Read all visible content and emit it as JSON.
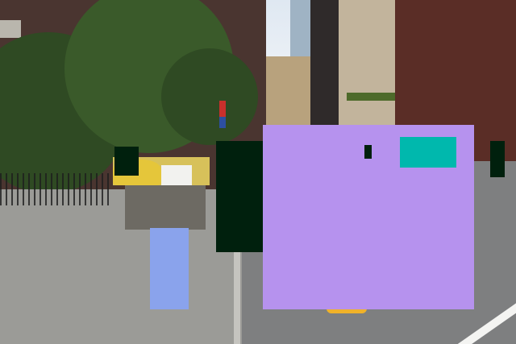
{
  "scene": {
    "subject": "",
    "colors": {
      "block_lavender": "#b692ee",
      "block_teal": "#00b8ad",
      "block_periwinkle": "#8aa3ec",
      "block_dark": "#00200d"
    }
  }
}
